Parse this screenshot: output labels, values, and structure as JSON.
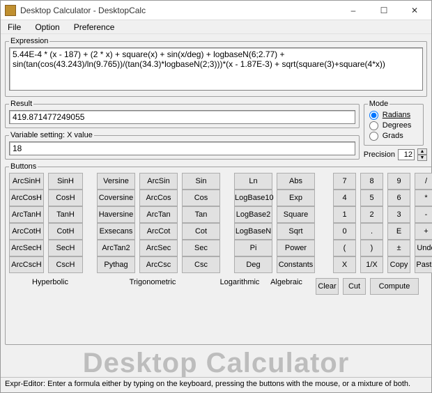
{
  "window": {
    "title": "Desktop Calculator - DesktopCalc"
  },
  "menu": {
    "file": "File",
    "option": "Option",
    "preference": "Preference"
  },
  "expression": {
    "legend": "Expression",
    "value": "5.44E-4 * (x - 187) + (2 * x) + square(x) + sin(x/deg) + logbaseN(6;2.77) + sin(tan(cos(43.243)/ln(9.765))/(tan(34.3)*logbaseN(2;3)))*(x - 1.87E-3) + sqrt(square(3)+square(4*x))"
  },
  "result": {
    "legend": "Result",
    "value": "419.871477249055"
  },
  "variable": {
    "legend": "Variable setting: X value",
    "value": "18"
  },
  "mode": {
    "legend": "Mode",
    "options": {
      "radians": "Radians",
      "degrees": "Degrees",
      "grads": "Grads"
    }
  },
  "precision": {
    "label": "Precision",
    "value": "12"
  },
  "buttons_legend": "Buttons",
  "btns": {
    "r1": [
      "ArcSinH",
      "SinH",
      "Versine",
      "ArcSin",
      "Sin",
      "Ln",
      "Abs",
      "7",
      "8",
      "9",
      "/"
    ],
    "r2": [
      "ArcCosH",
      "CosH",
      "Coversine",
      "ArcCos",
      "Cos",
      "LogBase10",
      "Exp",
      "4",
      "5",
      "6",
      "*"
    ],
    "r3": [
      "ArcTanH",
      "TanH",
      "Haversine",
      "ArcTan",
      "Tan",
      "LogBase2",
      "Square",
      "1",
      "2",
      "3",
      "-"
    ],
    "r4": [
      "ArcCotH",
      "CotH",
      "Exsecans",
      "ArcCot",
      "Cot",
      "LogBaseN",
      "Sqrt",
      "0",
      ".",
      "E",
      "+"
    ],
    "r5": [
      "ArcSecH",
      "SecH",
      "ArcTan2",
      "ArcSec",
      "Sec",
      "Pi",
      "Power",
      "(",
      ")",
      "±",
      "Undo"
    ],
    "r6": [
      "ArcCscH",
      "CscH",
      "Pythag",
      "ArcCsc",
      "Csc",
      "Deg",
      "Constants",
      "X",
      "1/X",
      "Copy",
      "Paste"
    ]
  },
  "categories": {
    "hyperbolic": "Hyperbolic",
    "trigonometric": "Trigonometric",
    "logarithmic": "Logarithmic",
    "algebraic": "Algebraic"
  },
  "actions": {
    "clear": "Clear",
    "cut": "Cut",
    "compute": "Compute"
  },
  "brand": "Desktop Calculator",
  "statusbar": "Expr-Editor: Enter a formula either by typing on the keyboard, pressing the buttons with the mouse, or a mixture of both."
}
